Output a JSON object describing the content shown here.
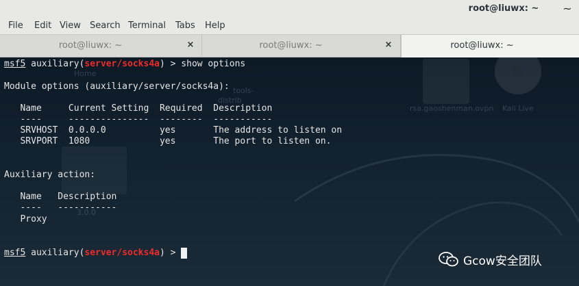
{
  "window": {
    "title": "root@liuwx: ~",
    "close_glyph": "~"
  },
  "menu": [
    "File",
    "Edit",
    "View",
    "Search",
    "Terminal",
    "Tabs",
    "Help"
  ],
  "tabs": [
    {
      "label": "root@liuwx: ~",
      "active": false,
      "close": "×"
    },
    {
      "label": "root@liuwx: ~",
      "active": false,
      "close": "×"
    },
    {
      "label": "root@liuwx: ~",
      "active": true
    }
  ],
  "terminal": {
    "prompt_word": "msf5",
    "prompt_mid": " auxiliary(",
    "module": "server/socks4a",
    "prompt_end": ") > ",
    "command": "show options",
    "module_options_header": "Module options (auxiliary/server/socks4a):",
    "options_header": "   Name     Current Setting  Required  Description",
    "options_rule": "   ----     ---------------  --------  -----------",
    "options_rows": [
      "   SRVHOST  0.0.0.0          yes       The address to listen on",
      "   SRVPORT  1080             yes       The port to listen on."
    ],
    "action_header": "Auxiliary action:",
    "action_cols": "   Name   Description",
    "action_rule": "   ----   -----------",
    "action_rows": [
      "   Proxy"
    ]
  },
  "background": {
    "labels": [
      "Home",
      "tools-",
      "distrib",
      "rsa.gaoshenman.ovpn",
      "Kali Live",
      "3.0.0"
    ]
  },
  "watermark": {
    "text": "Gcow安全团队",
    "icon": "wechat-icon"
  },
  "colors": {
    "prompt_module": "#ef2b2b",
    "terminal_text": "#e6e6e6",
    "terminal_bg": "#0c1a26"
  }
}
